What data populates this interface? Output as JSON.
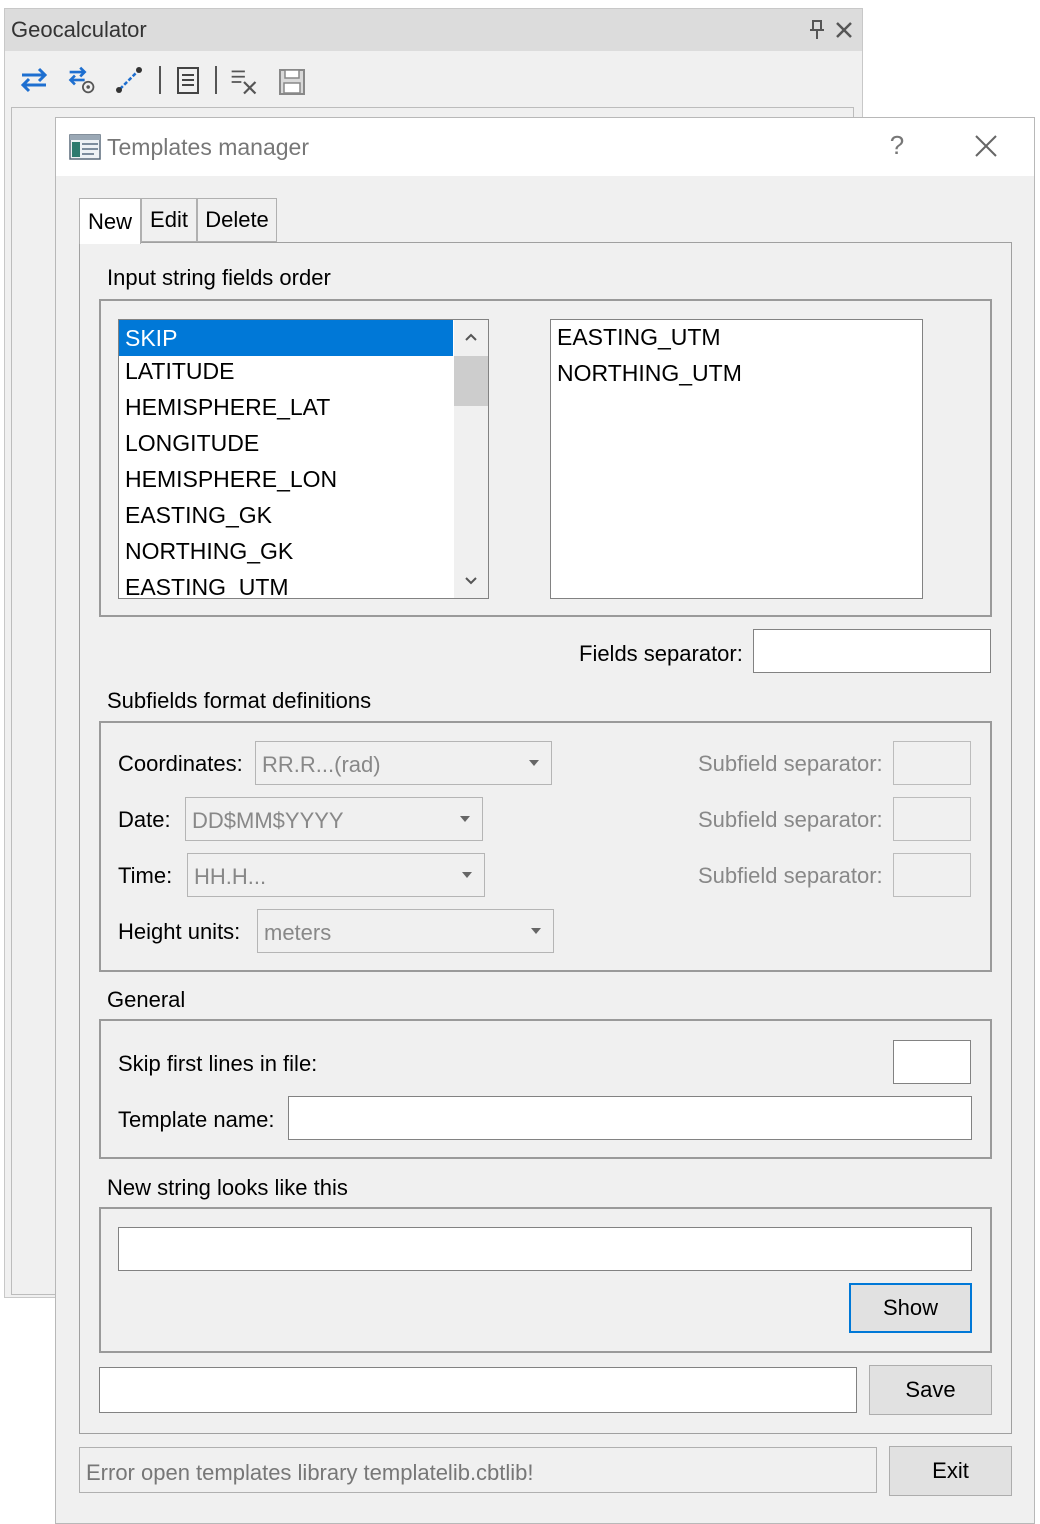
{
  "geocalculator": {
    "title": "Geocalculator"
  },
  "dialog": {
    "title": "Templates manager",
    "help_label": "?"
  },
  "tabs": [
    {
      "label": "New"
    },
    {
      "label": "Edit"
    },
    {
      "label": "Delete"
    }
  ],
  "input_order": {
    "heading": "Input string fields order",
    "available": [
      "SKIP",
      "LATITUDE",
      "HEMISPHERE_LAT",
      "LONGITUDE",
      "HEMISPHERE_LON",
      "EASTING_GK",
      "NORTHING_GK",
      "EASTING_UTM"
    ],
    "selected_item": "SKIP",
    "chosen": [
      "EASTING_UTM",
      "NORTHING_UTM"
    ],
    "fields_separator_label": "Fields separator:",
    "fields_separator_value": ""
  },
  "subfields": {
    "heading": "Subfields format definitions",
    "coordinates_label": "Coordinates:",
    "coordinates_value": "RR.R...(rad)",
    "date_label": "Date:",
    "date_value": "DD$MM$YYYY",
    "time_label": "Time:",
    "time_value": "HH.H...",
    "height_label": "Height units:",
    "height_value": "meters",
    "subfield_separator_label": "Subfield separator:"
  },
  "general": {
    "heading": "General",
    "skip_lines_label": "Skip first lines in file:",
    "skip_lines_value": "",
    "template_name_label": "Template name:",
    "template_name_value": ""
  },
  "preview": {
    "heading": "New string looks like this",
    "value": "",
    "show_label": "Show"
  },
  "save_row": {
    "value": "",
    "save_label": "Save"
  },
  "status": {
    "message": "Error open templates library templatelib.cbtlib!",
    "exit_label": "Exit"
  },
  "colors": {
    "selection": "#0078d7",
    "icon_blue": "#1e6fd0"
  }
}
